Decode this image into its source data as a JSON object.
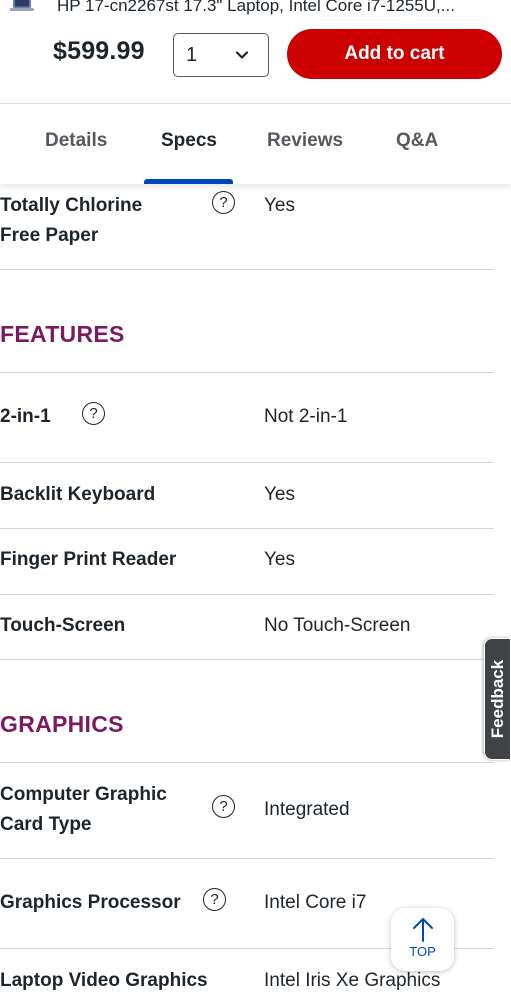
{
  "header": {
    "product_title": "HP 17-cn2267st 17.3\" Laptop, Intel Core i7-1255U,...",
    "thumbnail_icon": "laptop-thumbnail",
    "price": "$599.99",
    "quantity": "1",
    "add_to_cart": "Add to cart",
    "cart_color": "#cc0000"
  },
  "tabs": [
    {
      "label": "Details",
      "active": false
    },
    {
      "label": "Specs",
      "active": true
    },
    {
      "label": "Reviews",
      "active": false
    },
    {
      "label": "Q&A",
      "active": false
    }
  ],
  "specs_top": [
    {
      "label_line1": "Totally Chlorine",
      "label_line2": "Free Paper",
      "value": "Yes",
      "help_icon": "question-circle-icon"
    }
  ],
  "sections": [
    {
      "title": "FEATURES",
      "rows": [
        {
          "label": "2-in-1",
          "value": "Not 2-in-1"
        },
        {
          "label": "Backlit Keyboard",
          "value": "Yes"
        },
        {
          "label": "Finger Print Reader",
          "value": "Yes"
        },
        {
          "label": "Touch-Screen",
          "value": "No Touch-Screen"
        }
      ]
    },
    {
      "title": "GRAPHICS",
      "rows": [
        {
          "label_line1": "Computer Graphic",
          "label_line2": "Card Type",
          "value": "Integrated"
        },
        {
          "label": "Graphics Processor",
          "value": "Intel Core i7"
        },
        {
          "label": "Laptop Video Graphics",
          "value": "Intel Iris Xe Graphics"
        }
      ]
    }
  ],
  "help_glyph": "?",
  "feedback_label": "Feedback",
  "top_button_label": "TOP",
  "colors": {
    "section_title": "#7b1a5f",
    "accent": "#0046be",
    "feedback_bg": "#3f4246"
  }
}
